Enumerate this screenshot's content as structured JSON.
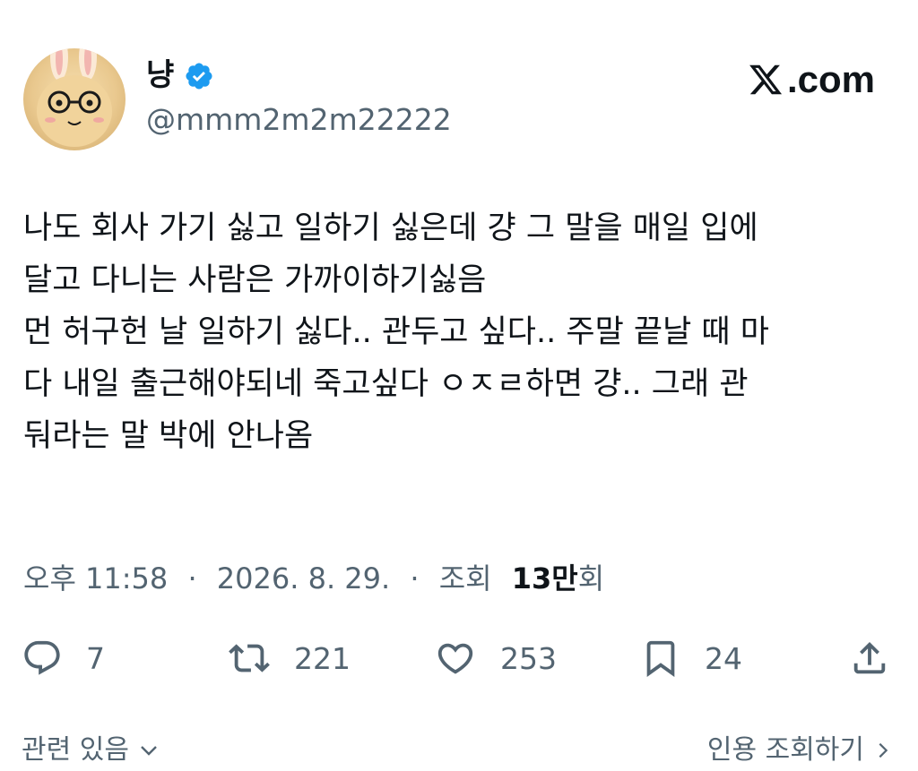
{
  "header": {
    "display_name": "냥",
    "handle": "@mmm2m2m22222",
    "brand": ".com",
    "verified": true,
    "verified_color": "#1d9bf0"
  },
  "tweet": {
    "lines": [
      "나도 회사 가기 싫고 일하기 싫은데 걍 그 말을 매일 입에",
      "달고 다니는 사람은 가까이하기싫음",
      "먼 허구헌 날 일하기 싫다.. 관두고 싶다.. 주말 끝날 때 마",
      "다 내일 출근해야되네 죽고싶다 ㅇㅈㄹ하면 걍.. 그래 관",
      "둬라는 말 박에 안나옴"
    ]
  },
  "meta": {
    "time": "오후 11:58",
    "separator": "·",
    "date": "2026. 8. 29.",
    "views_label": "조회",
    "views_count": "13만",
    "views_suffix": "회"
  },
  "actions": {
    "replies": "7",
    "retweets": "221",
    "likes": "253",
    "bookmarks": "24",
    "icons": [
      "reply-icon",
      "retweet-icon",
      "like-icon",
      "bookmark-icon",
      "share-icon"
    ]
  },
  "footer": {
    "related_label": "관련 있음",
    "quotes_label": "인용 조회하기"
  }
}
